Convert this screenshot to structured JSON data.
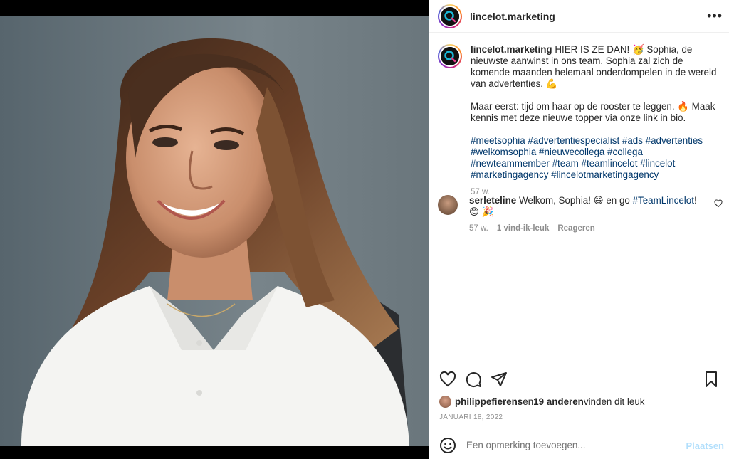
{
  "account": {
    "username": "lincelot.marketing"
  },
  "caption": {
    "username": "lincelot.marketing",
    "line1": "HIER IS ZE DAN! 🥳 Sophia, de nieuwste aanwinst in ons team. Sophia zal zich de komende maanden helemaal onderdompelen in de wereld van advertenties. 💪",
    "line2": "Maar eerst: tijd om haar op de rooster te leggen. 🔥 Maak kennis met deze nieuwe topper via onze link in bio.",
    "hashtags": "#meetsophia #advertentiespecialist #ads #advertenties #welkomsophia #nieuwecollega #collega #newteammember #team #teamlincelot #lincelot #marketingagency #lincelotmarketingagency",
    "age": "57 w."
  },
  "comment": {
    "username": "serleteline",
    "text_before": "Welkom, Sophia! 😄 en go ",
    "tag": "#TeamLincelot",
    "text_after": "! 😊 🎉",
    "age": "57 w.",
    "likes": "1 vind-ik-leuk",
    "reply": "Reageren"
  },
  "likes": {
    "user": "philippefierens",
    "mid": " en ",
    "count": "19 anderen",
    "tail": " vinden dit leuk"
  },
  "date": "JANUARI 18, 2022",
  "add_comment": {
    "placeholder": "Een opmerking toevoegen...",
    "post_label": "Plaatsen"
  },
  "icons": {
    "more": "more-options-icon",
    "like": "heart-icon",
    "comment": "comment-icon",
    "share": "share-icon",
    "save": "bookmark-icon",
    "emoji": "emoji-icon"
  },
  "colors": {
    "link": "#00376b",
    "muted": "#8e8e8e",
    "post_disabled": "#b2dffc"
  }
}
